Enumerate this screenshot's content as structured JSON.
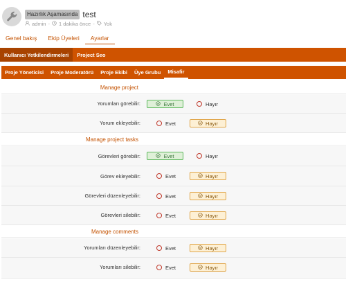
{
  "header": {
    "phase_badge": "Hazırlık Aşamasında",
    "title": "test",
    "meta": {
      "user": "admin",
      "time": "1 dakika önce",
      "tag": "Yok"
    }
  },
  "main_tabs": [
    "Genel bakış",
    "Ekip Üyeleri",
    "Ayarlar"
  ],
  "settings_tabs": [
    "Kullanıcı Yetkilendirmeleri",
    "Project Seo"
  ],
  "role_tabs": [
    "Proje Yöneticisi",
    "Proje Moderatörü",
    "Proje Ekibi",
    "Üye Grubu",
    "Misafir"
  ],
  "options": {
    "yes": "Evet",
    "no": "Hayır"
  },
  "sections": [
    {
      "title": "Manage project",
      "rows": [
        {
          "label": "Yorumları görebilir:",
          "value": "yes"
        },
        {
          "label": "Yorum ekleyebilir:",
          "value": "no"
        }
      ]
    },
    {
      "title": "Manage project tasks",
      "rows": [
        {
          "label": "Görevleri görebilir:",
          "value": "yes"
        },
        {
          "label": "Görev ekleyebilir:",
          "value": "no"
        },
        {
          "label": "Görevleri düzenleyebilir:",
          "value": "no"
        },
        {
          "label": "Görevleri silebilir:",
          "value": "no"
        }
      ]
    },
    {
      "title": "Manage comments",
      "rows": [
        {
          "label": "Yorumları düzenleyebilir:",
          "value": "no"
        },
        {
          "label": "Yorumları silebilir:",
          "value": "no"
        }
      ]
    }
  ]
}
